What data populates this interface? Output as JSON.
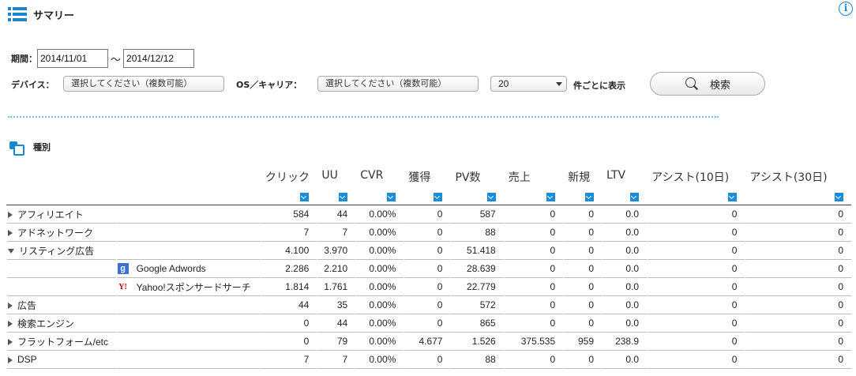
{
  "header": {
    "title": "サマリー",
    "list_icon": "list-icon",
    "info_icon": "info-icon"
  },
  "filters": {
    "period_label": "期間：",
    "date_from": "2014/11/01",
    "tilde": "～",
    "date_to": "2014/12/12",
    "device_label": "デバイス：",
    "device_placeholder": "選択してください（複数可能）",
    "os_label": "OS／キャリア：",
    "os_placeholder": "選択してください（複数可能）",
    "per_page_value": "20",
    "per_page_suffix": "件ごとに表示",
    "search_label": "検索"
  },
  "section": {
    "title": "種別"
  },
  "table": {
    "columns": [
      "クリック",
      "UU",
      "CVR",
      "獲得",
      "PV数",
      "売上",
      "新規",
      "LTV",
      "アシスト(10日)",
      "アシスト(30日)"
    ],
    "rows": [
      {
        "name": "アフィリエイト",
        "expand": "collapsed",
        "values": [
          "584",
          "44",
          "0.00%",
          "0",
          "587",
          "0",
          "0",
          "0.0",
          "0",
          "0"
        ]
      },
      {
        "name": "アドネットワーク",
        "expand": "collapsed",
        "values": [
          "7",
          "7",
          "0.00%",
          "0",
          "88",
          "0",
          "0",
          "0.0",
          "0",
          "0"
        ]
      },
      {
        "name": "リスティング広告",
        "expand": "expanded",
        "values": [
          "4.100",
          "3.970",
          "0.00%",
          "0",
          "51.418",
          "0",
          "0",
          "0.0",
          "0",
          "0"
        ]
      },
      {
        "name": "Google Adwords",
        "sub": true,
        "icon": "google-icon",
        "icon_text": "g",
        "values": [
          "2.286",
          "2.210",
          "0.00%",
          "0",
          "28.639",
          "0",
          "0",
          "0.0",
          "0",
          "0"
        ]
      },
      {
        "name": "Yahoo!スポンサードサーチ",
        "sub": true,
        "icon": "yahoo-icon",
        "icon_text": "Y!",
        "values": [
          "1.814",
          "1.761",
          "0.00%",
          "0",
          "22.779",
          "0",
          "0",
          "0.0",
          "0",
          "0"
        ]
      },
      {
        "name": "広告",
        "expand": "collapsed",
        "values": [
          "44",
          "35",
          "0.00%",
          "0",
          "572",
          "0",
          "0",
          "0.0",
          "0",
          "0"
        ]
      },
      {
        "name": "検索エンジン",
        "expand": "collapsed",
        "values": [
          "0",
          "44",
          "0.00%",
          "0",
          "865",
          "0",
          "0",
          "0.0",
          "0",
          "0"
        ]
      },
      {
        "name": "フラットフォーム/etc",
        "expand": "collapsed",
        "values": [
          "0",
          "79",
          "0.00%",
          "4.677",
          "1.526",
          "375.535",
          "959",
          "238.9",
          "0",
          "0"
        ]
      },
      {
        "name": "DSP",
        "expand": "collapsed",
        "values": [
          "7",
          "7",
          "0.00%",
          "0",
          "88",
          "0",
          "0",
          "0.0",
          "0",
          "0"
        ]
      }
    ]
  },
  "colors": {
    "accent": "#1a86d0",
    "divider": "#6cc4e0"
  }
}
